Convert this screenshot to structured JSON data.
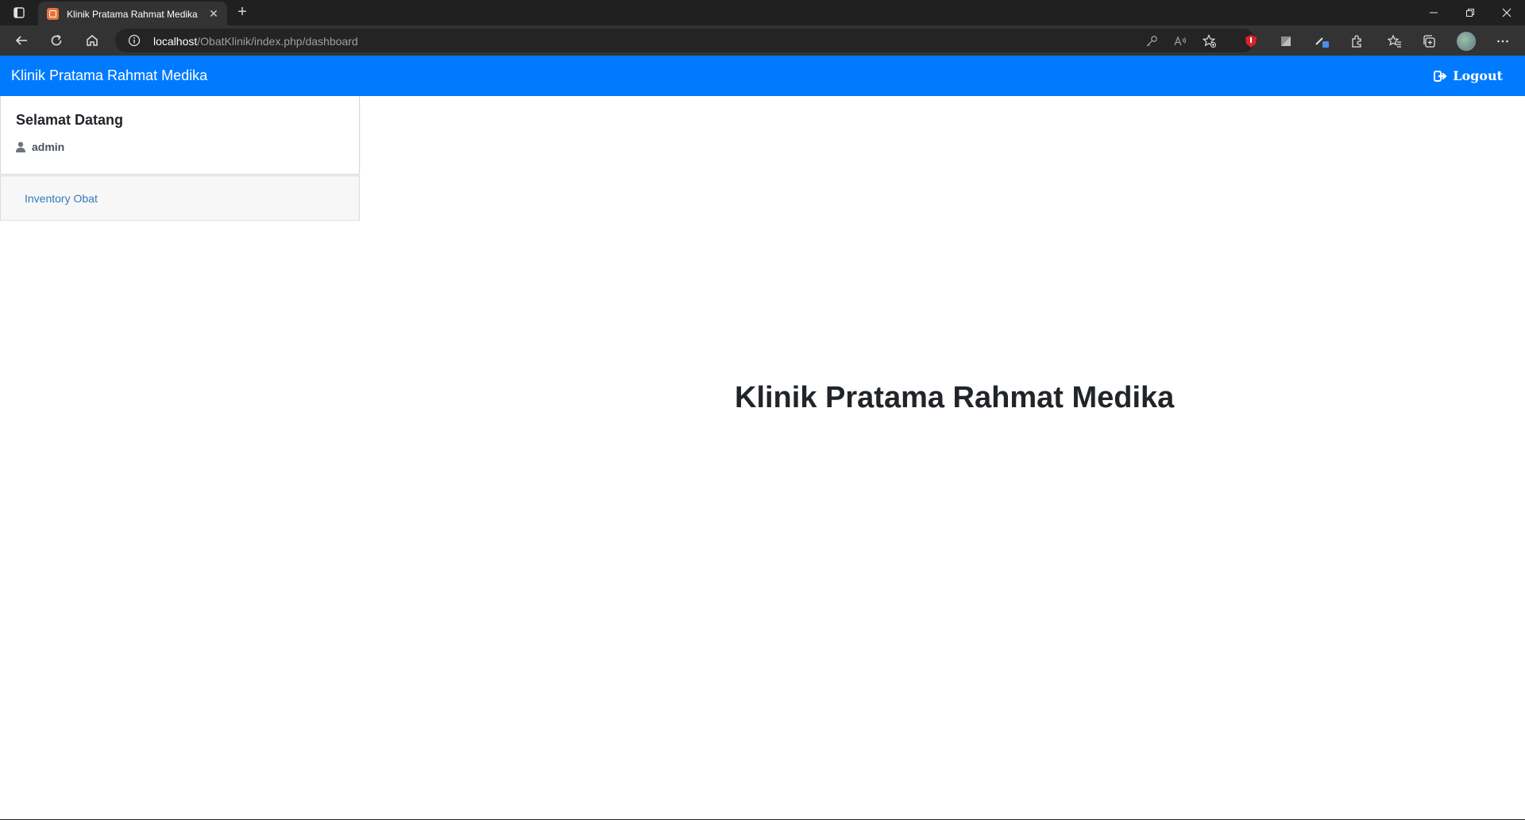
{
  "browser": {
    "tab_title": "Klinik Pratama Rahmat Medika",
    "url_host": "localhost",
    "url_path": "/ObatKlinik/index.php/dashboard",
    "icons": [
      "tab-actions-icon",
      "new-tab-icon",
      "back-icon",
      "refresh-icon",
      "home-icon",
      "site-info-icon",
      "key-icon",
      "read-aloud-icon",
      "add-favorite-icon",
      "extension-icon",
      "favorites-icon",
      "collections-icon",
      "profile-avatar",
      "more-icon"
    ]
  },
  "header": {
    "brand": "Klinik Pratama Rahmat Medika",
    "logout_label": "Logout",
    "background_color": "#007bff"
  },
  "sidebar": {
    "welcome_title": "Selamat Datang",
    "username": "admin",
    "menu_items": [
      {
        "label": "Inventory Obat"
      }
    ]
  },
  "main": {
    "title": "Klinik Pratama Rahmat Medika"
  }
}
